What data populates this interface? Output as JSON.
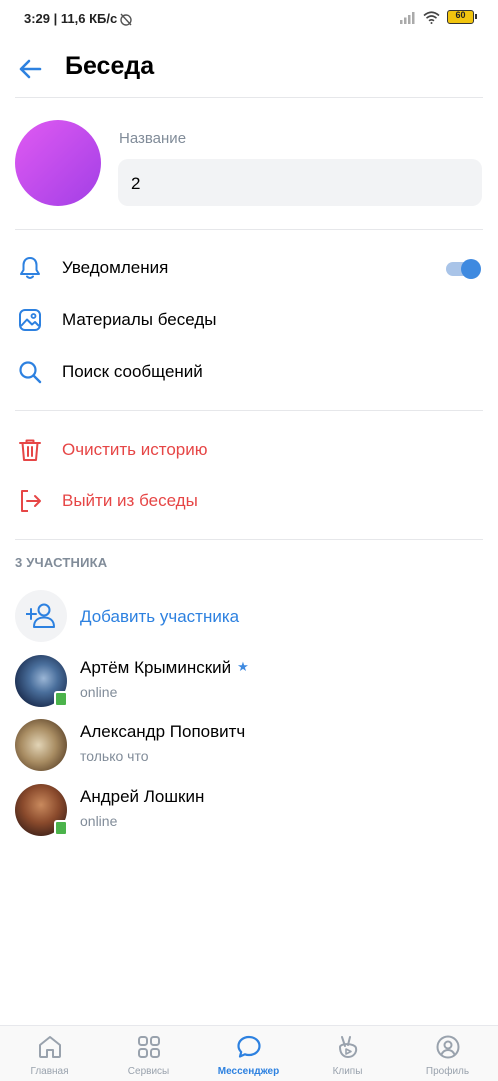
{
  "status_bar": {
    "time_speed": "3:29 | 11,6 КБ/с",
    "battery": "60"
  },
  "header": {
    "title": "Беседа"
  },
  "chat": {
    "name_label": "Название",
    "name_value": "2"
  },
  "settings": {
    "notifications": "Уведомления",
    "notifications_on": true,
    "materials": "Материалы беседы",
    "search": "Поиск сообщений"
  },
  "actions": {
    "clear_history": "Очистить историю",
    "leave": "Выйти из беседы"
  },
  "members": {
    "header": "3 УЧАСТНИКА",
    "add_label": "Добавить участника",
    "list": [
      {
        "name": "Артём Крыминский",
        "status": "online",
        "verified": true
      },
      {
        "name": "Александр Поповитч",
        "status": "только что",
        "verified": false
      },
      {
        "name": "Андрей Лошкин",
        "status": "online",
        "verified": false
      }
    ]
  },
  "tabbar": {
    "items": [
      {
        "label": "Главная",
        "icon": "home-icon"
      },
      {
        "label": "Сервисы",
        "icon": "services-icon"
      },
      {
        "label": "Мессенджер",
        "icon": "messenger-icon"
      },
      {
        "label": "Клипы",
        "icon": "clips-icon"
      },
      {
        "label": "Профиль",
        "icon": "profile-icon"
      }
    ],
    "active": "Мессенджер"
  },
  "colors": {
    "accent": "#2d81e0",
    "danger": "#e64646",
    "secondary_text": "#818c99"
  }
}
